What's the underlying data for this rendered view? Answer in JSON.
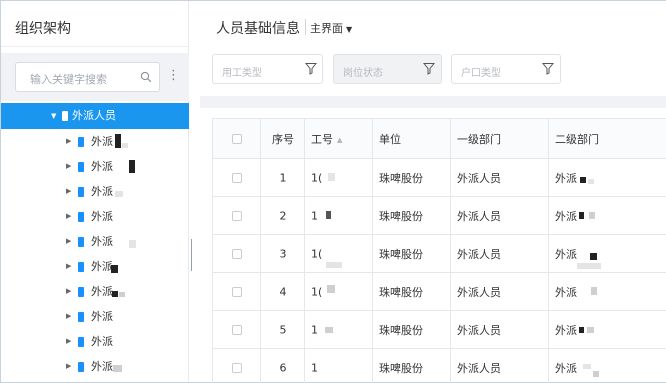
{
  "sidebar": {
    "title": "组织架构",
    "search_placeholder": "输入关键字搜索",
    "root": {
      "label": "外派人员"
    },
    "children": [
      {
        "label": "外派"
      },
      {
        "label": "外派"
      },
      {
        "label": "外派"
      },
      {
        "label": "外派"
      },
      {
        "label": "外派"
      },
      {
        "label": "外派"
      },
      {
        "label": "外派"
      },
      {
        "label": "外派"
      },
      {
        "label": "外派"
      },
      {
        "label": "外派"
      }
    ]
  },
  "header": {
    "title": "人员基础信息",
    "view_label": "主界面",
    "view_arrow": "▼"
  },
  "filters": [
    {
      "placeholder": "用工类型",
      "disabled": false
    },
    {
      "placeholder": "岗位状态",
      "disabled": true
    },
    {
      "placeholder": "户口类型",
      "disabled": false
    }
  ],
  "table": {
    "columns": [
      "",
      "序号",
      "工号",
      "单位",
      "一级部门",
      "二级部门"
    ],
    "rows": [
      {
        "index": "1",
        "emp_no": "1(",
        "unit": "珠啤股份",
        "dept1": "外派人员",
        "dept2": "外派"
      },
      {
        "index": "2",
        "emp_no": "1",
        "unit": "珠啤股份",
        "dept1": "外派人员",
        "dept2": "外派"
      },
      {
        "index": "3",
        "emp_no": "1(",
        "unit": "珠啤股份",
        "dept1": "外派人员",
        "dept2": "外派"
      },
      {
        "index": "4",
        "emp_no": "1(",
        "unit": "珠啤股份",
        "dept1": "外派人员",
        "dept2": "外派"
      },
      {
        "index": "5",
        "emp_no": "1",
        "unit": "珠啤股份",
        "dept1": "外派人员",
        "dept2": "外派"
      },
      {
        "index": "6",
        "emp_no": "1",
        "unit": "珠啤股份",
        "dept1": "外派人员",
        "dept2": "外派"
      }
    ]
  },
  "colors": {
    "accent": "#1b96ee",
    "border": "#e4e7ec",
    "background": "#f0f2f5"
  }
}
